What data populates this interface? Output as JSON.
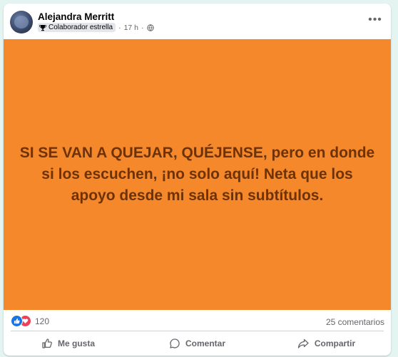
{
  "post": {
    "author": "Alejandra Merritt",
    "badge": "Colaborador estrella",
    "time": "17 h",
    "separator": "·",
    "text": "SI SE VAN A QUEJAR, QUÉJENSE, pero en donde si los escuchen, ¡no solo aquí! Neta que los apoyo desde mi sala sin subtítulos.",
    "background_color": "#f5882a",
    "text_color": "#6e3207"
  },
  "stats": {
    "reactions_count": "120",
    "comments": "25 comentarios"
  },
  "actions": {
    "like": "Me gusta",
    "comment": "Comentar",
    "share": "Compartir"
  },
  "icons": {
    "more": "more-options-icon",
    "privacy": "globe-icon",
    "badge": "trophy-icon"
  },
  "colors": {
    "like_blue": "#1b74e4",
    "love_red": "#f33e58"
  }
}
